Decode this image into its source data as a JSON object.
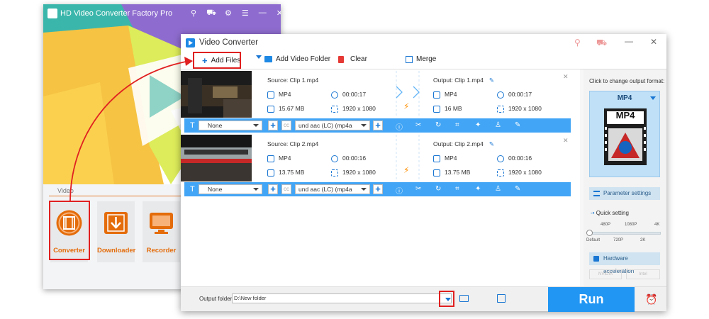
{
  "main_window": {
    "title": "HD Video Converter Factory Pro",
    "section_label": "Video",
    "tools": [
      {
        "label": "Converter",
        "icon": "film-icon"
      },
      {
        "label": "Downloader",
        "icon": "download-icon"
      },
      {
        "label": "Recorder",
        "icon": "monitor-icon"
      }
    ]
  },
  "converter_window": {
    "title": "Video Converter",
    "toolbar": {
      "add_files": "Add Files",
      "add_video_folder": "Add Video Folder",
      "clear": "Clear",
      "merge": "Merge"
    },
    "files": [
      {
        "source": "Source: Clip 1.mp4",
        "src_format": "MP4",
        "src_duration": "00:00:17",
        "src_size": "15.67 MB",
        "src_resolution": "1920 x 1080",
        "output": "Output: Clip 1.mp4",
        "out_format": "MP4",
        "out_duration": "00:00:17",
        "out_size": "16 MB",
        "out_resolution": "1920 x 1080",
        "subtitle": "None",
        "audio": "und aac (LC) (mp4a"
      },
      {
        "source": "Source: Clip 2.mp4",
        "src_format": "MP4",
        "src_duration": "00:00:16",
        "src_size": "13.75 MB",
        "src_resolution": "1920 x 1080",
        "output": "Output: Clip 2.mp4",
        "out_format": "MP4",
        "out_duration": "00:00:16",
        "out_size": "13.75 MB",
        "out_resolution": "1920 x 1080",
        "subtitle": "None",
        "audio": "und aac (LC) (mp4a"
      }
    ],
    "sidebar": {
      "hint": "Click to change output format:",
      "format": "MP4",
      "format_badge": "MP4",
      "parameter_settings": "Parameter settings",
      "quick_setting": "Quick setting",
      "scale_top": [
        "480P",
        "1080P",
        "4K"
      ],
      "scale_bottom": [
        "Default",
        "720P",
        "2K"
      ],
      "hardware_acceleration": "Hardware acceleration",
      "gpu1": "NVIDIA",
      "gpu2": "Intel"
    },
    "footer": {
      "output_folder_label": "Output folder:",
      "output_folder_value": "D:\\New folder",
      "run": "Run"
    }
  },
  "colors": {
    "accent": "#42a5f5",
    "run": "#2196f3",
    "highlight": "#e02020",
    "orange": "#e46c0a"
  }
}
